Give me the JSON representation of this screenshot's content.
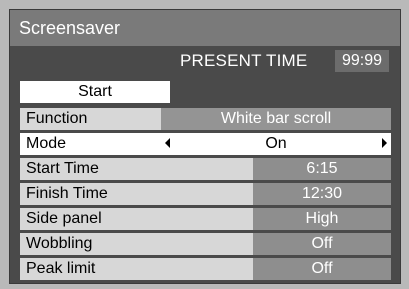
{
  "menu": {
    "title": "Screensaver",
    "present_time_label": "PRESENT TIME",
    "present_time_value": "99:99",
    "start_label": "Start",
    "rows": [
      {
        "label": "Function",
        "value": "White bar scroll"
      },
      {
        "label": "Mode",
        "value": "On"
      },
      {
        "label": "Start Time",
        "value": "6:15"
      },
      {
        "label": "Finish Time",
        "value": "12:30"
      },
      {
        "label": "Side panel",
        "value": "High"
      },
      {
        "label": "Wobbling",
        "value": "Off"
      },
      {
        "label": "Peak limit",
        "value": "Off"
      }
    ]
  },
  "colors": {
    "panel_bg": "#4a4a4a",
    "title_bg": "#7a7a7a",
    "label_bg": "#d7d7d7",
    "value_bg": "#8e8e8e",
    "selected_bg": "#ffffff"
  },
  "icons": {
    "mode_prev": "triangle-left-icon",
    "mode_next": "triangle-right-icon"
  }
}
